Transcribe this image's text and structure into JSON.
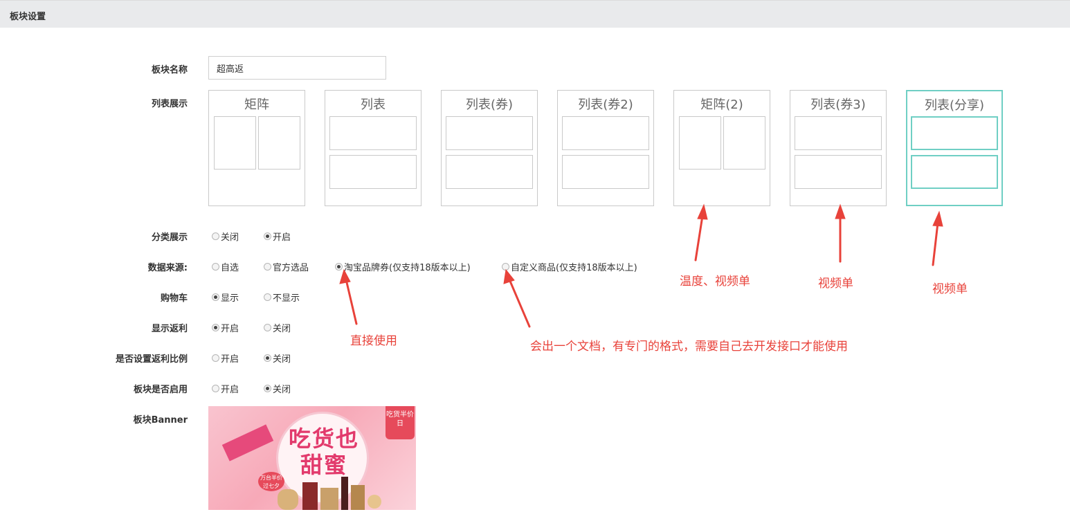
{
  "header": {
    "title": "板块设置"
  },
  "labels": {
    "block_name": "板块名称",
    "list_display": "列表展示",
    "category_display": "分类展示",
    "data_source": "数据来源:",
    "cart": "购物车",
    "show_rebate": "显示返利",
    "set_rebate_ratio": "是否设置返利比例",
    "block_enabled": "板块是否启用",
    "block_banner": "板块Banner"
  },
  "block_name": {
    "value": "超高返"
  },
  "layouts": [
    {
      "title": "矩阵",
      "style": "grid",
      "selected": false
    },
    {
      "title": "列表",
      "style": "list",
      "selected": false
    },
    {
      "title": "列表(券)",
      "style": "list",
      "selected": false
    },
    {
      "title": "列表(券2)",
      "style": "list",
      "selected": false
    },
    {
      "title": "矩阵(2)",
      "style": "grid",
      "selected": false
    },
    {
      "title": "列表(券3)",
      "style": "list",
      "selected": false
    },
    {
      "title": "列表(分享)",
      "style": "list",
      "selected": true
    }
  ],
  "category_display": {
    "options": [
      {
        "label": "关闭",
        "checked": false
      },
      {
        "label": "开启",
        "checked": true
      }
    ]
  },
  "data_source": {
    "options": [
      {
        "label": "自选",
        "checked": false
      },
      {
        "label": "官方选品",
        "checked": false
      },
      {
        "label": "淘宝品牌券(仅支持18版本以上)",
        "checked": true
      },
      {
        "label": "自定义商品(仅支持18版本以上)",
        "checked": false
      }
    ]
  },
  "cart": {
    "options": [
      {
        "label": "显示",
        "checked": true
      },
      {
        "label": "不显示",
        "checked": false
      }
    ]
  },
  "show_rebate": {
    "options": [
      {
        "label": "开启",
        "checked": true
      },
      {
        "label": "关闭",
        "checked": false
      }
    ]
  },
  "set_rebate_ratio": {
    "options": [
      {
        "label": "开启",
        "checked": false
      },
      {
        "label": "关闭",
        "checked": true
      }
    ]
  },
  "block_enabled": {
    "options": [
      {
        "label": "开启",
        "checked": false
      },
      {
        "label": "关闭",
        "checked": true
      }
    ]
  },
  "annotations": {
    "direct_use": "直接使用",
    "custom_doc": "会出一个文档，有专门的格式，需要自己去开发接口才能使用",
    "matrix2_note": "温度、视频单",
    "list3_note": "视频单",
    "share_note": "视频单"
  },
  "banner": {
    "main_text": "吃货也甜蜜",
    "tag_text": "吃货半价日",
    "small_text": "万台半价过七夕"
  },
  "colors": {
    "annotation_red": "#e8423a",
    "selected_border": "#6fcfc4",
    "header_bg": "#e9eaec"
  }
}
